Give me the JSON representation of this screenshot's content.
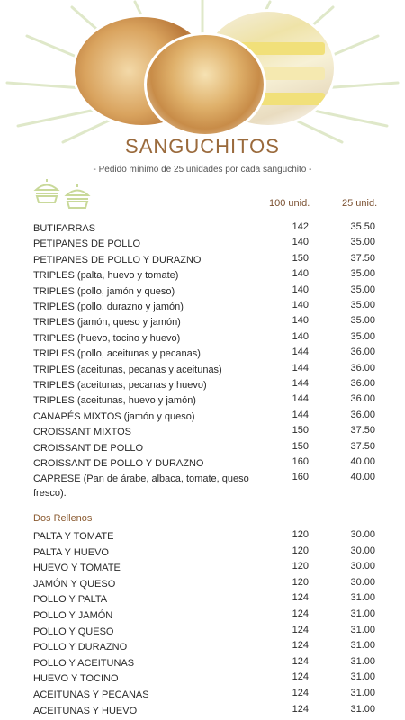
{
  "header": {
    "title": "SANGUCHITOS",
    "subtitle": "- Pedido mínimo de 25 unidades por cada sanguchito -"
  },
  "columns": {
    "c100": "100 unid.",
    "c25": "25 unid."
  },
  "items": [
    {
      "name": "BUTIFARRAS",
      "p100": "142",
      "p25": "35.50"
    },
    {
      "name": "PETIPANES DE POLLO",
      "p100": "140",
      "p25": "35.00"
    },
    {
      "name": "PETIPANES DE POLLO Y DURAZNO",
      "p100": "150",
      "p25": "37.50"
    },
    {
      "name": "TRIPLES (palta, huevo y tomate)",
      "p100": "140",
      "p25": "35.00"
    },
    {
      "name": "TRIPLES (pollo, jamón y queso)",
      "p100": "140",
      "p25": "35.00"
    },
    {
      "name": "TRIPLES (pollo, durazno y jamón)",
      "p100": "140",
      "p25": "35.00"
    },
    {
      "name": "TRIPLES (jamón, queso y jamón)",
      "p100": "140",
      "p25": "35.00"
    },
    {
      "name": "TRIPLES (huevo, tocino y huevo)",
      "p100": "140",
      "p25": "35.00"
    },
    {
      "name": "TRIPLES (pollo, aceitunas y pecanas)",
      "p100": "144",
      "p25": "36.00"
    },
    {
      "name": "TRIPLES (aceitunas, pecanas y aceitunas)",
      "p100": "144",
      "p25": "36.00"
    },
    {
      "name": "TRIPLES (aceitunas, pecanas y huevo)",
      "p100": "144",
      "p25": "36.00"
    },
    {
      "name": "TRIPLES (aceitunas, huevo y jamón)",
      "p100": "144",
      "p25": "36.00"
    },
    {
      "name": "CANAPÉS MIXTOS (jamón y queso)",
      "p100": "144",
      "p25": "36.00"
    },
    {
      "name": "CROISSANT MIXTOS",
      "p100": "150",
      "p25": "37.50"
    },
    {
      "name": "CROISSANT DE POLLO",
      "p100": "150",
      "p25": "37.50"
    },
    {
      "name": "CROISSANT DE POLLO Y DURAZNO",
      "p100": "160",
      "p25": "40.00"
    },
    {
      "name": "CAPRESE (Pan de árabe, albaca, tomate, queso fresco).",
      "p100": "160",
      "p25": "40.00"
    }
  ],
  "section2": {
    "title": "Dos Rellenos",
    "items": [
      {
        "name": "PALTA Y TOMATE",
        "p100": "120",
        "p25": "30.00"
      },
      {
        "name": "PALTA Y HUEVO",
        "p100": "120",
        "p25": "30.00"
      },
      {
        "name": "HUEVO Y TOMATE",
        "p100": "120",
        "p25": "30.00"
      },
      {
        "name": "JAMÓN Y QUESO",
        "p100": "120",
        "p25": "30.00"
      },
      {
        "name": "POLLO Y PALTA",
        "p100": "124",
        "p25": "31.00"
      },
      {
        "name": "POLLO Y JAMÓN",
        "p100": "124",
        "p25": "31.00"
      },
      {
        "name": "POLLO Y QUESO",
        "p100": "124",
        "p25": "31.00"
      },
      {
        "name": "POLLO Y DURAZNO",
        "p100": "124",
        "p25": "31.00"
      },
      {
        "name": "POLLO Y ACEITUNAS",
        "p100": "124",
        "p25": "31.00"
      },
      {
        "name": "HUEVO Y TOCINO",
        "p100": "124",
        "p25": "31.00"
      },
      {
        "name": "ACEITUNAS Y PECANAS",
        "p100": "124",
        "p25": "31.00"
      },
      {
        "name": "ACEITUNAS Y HUEVO",
        "p100": "124",
        "p25": "31.00"
      }
    ]
  },
  "colors": {
    "accent": "#9a6a3c",
    "rays": "#dfe8c9",
    "icon": "#c9d99a"
  }
}
